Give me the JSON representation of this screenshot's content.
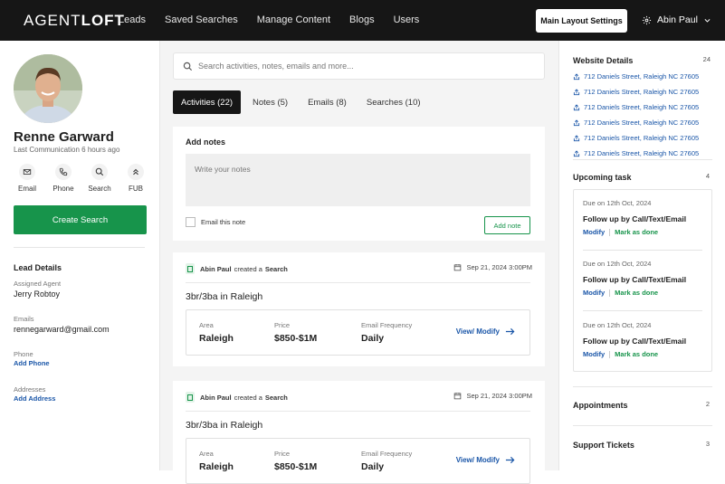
{
  "header": {
    "logo_light": "AGENT",
    "logo_bold": "LOFT",
    "nav": [
      "Leads",
      "Saved Searches",
      "Manage Content",
      "Blogs",
      "Users"
    ],
    "layout_button": "Main Layout Settings",
    "user_name": "Abin Paul"
  },
  "lead": {
    "name": "Renne Garward",
    "last_communication": "Last Communication 6 hours ago",
    "actions": [
      {
        "label": "Email",
        "icon": "mail-icon"
      },
      {
        "label": "Phone",
        "icon": "phone-icon"
      },
      {
        "label": "Search",
        "icon": "search-icon"
      },
      {
        "label": "FUB",
        "icon": "chevrons-up-icon"
      }
    ],
    "create_search": "Create Search",
    "details_title": "Lead Details",
    "assigned_agent_label": "Assigned Agent",
    "assigned_agent": "Jerry Robtoy",
    "emails_label": "Emails",
    "email": "rennegarward@gmail.com",
    "phone_label": "Phone",
    "add_phone": "Add Phone",
    "addresses_label": "Addresses",
    "add_address": "Add Address"
  },
  "main": {
    "search_placeholder": "Search activities, notes, emails and more...",
    "tabs": [
      "Activities (22)",
      "Notes (5)",
      "Emails (8)",
      "Searches (10)"
    ],
    "add_notes_title": "Add notes",
    "notes_placeholder": "Write your notes",
    "email_note_label": "Email this note",
    "add_note_button": "Add note",
    "activities": [
      {
        "actor": "Abin Paul",
        "verb": "created a",
        "object": "Search",
        "date": "Sep 21, 2024 3:00PM",
        "title": "3br/3ba in Raleigh",
        "area_label": "Area",
        "area": "Raleigh",
        "price_label": "Price",
        "price": "$850-$1M",
        "freq_label": "Email Frequency",
        "freq": "Daily",
        "link": "View/ Modify"
      },
      {
        "actor": "Abin Paul",
        "verb": "created a",
        "object": "Search",
        "date": "Sep 21, 2024 3:00PM",
        "title": "3br/3ba in Raleigh",
        "area_label": "Area",
        "area": "Raleigh",
        "price_label": "Price",
        "price": "$850-$1M",
        "freq_label": "Email Frequency",
        "freq": "Daily",
        "link": "View/ Modify"
      }
    ]
  },
  "sidebar_right": {
    "website_details_title": "Website Details",
    "website_details_count": "24",
    "addresses": [
      "712 Daniels Street, Raleigh NC 27605",
      "712 Daniels Street, Raleigh NC 27605",
      "712 Daniels Street, Raleigh NC 27605",
      "712 Daniels Street, Raleigh NC 27605",
      "712 Daniels Street, Raleigh NC 27605",
      "712 Daniels Street, Raleigh NC 27605"
    ],
    "upcoming_title": "Upcoming task",
    "upcoming_count": "4",
    "tasks": [
      {
        "due": "Due on 12th Oct, 2024",
        "title": "Follow up by Call/Text/Email",
        "modify": "Modify",
        "done": "Mark as done"
      },
      {
        "due": "Due on 12th Oct, 2024",
        "title": "Follow up by Call/Text/Email",
        "modify": "Modify",
        "done": "Mark as done"
      },
      {
        "due": "Due on 12th Oct, 2024",
        "title": "Follow up by Call/Text/Email",
        "modify": "Modify",
        "done": "Mark as done"
      }
    ],
    "appointments_title": "Appointments",
    "appointments_count": "2",
    "tickets_title": "Support Tickets",
    "tickets_count": "3"
  },
  "colors": {
    "brand_green": "#17944b",
    "link_blue": "#1a56a8",
    "topbar": "#161616"
  }
}
